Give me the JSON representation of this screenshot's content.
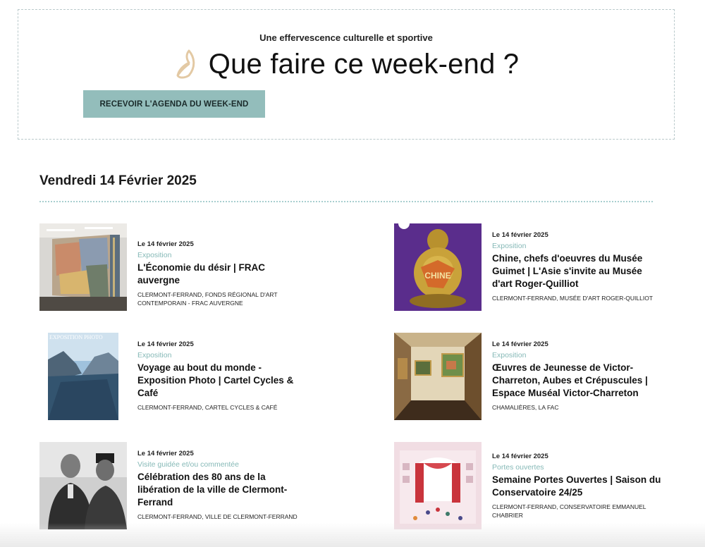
{
  "hero": {
    "subtitle": "Une effervescence culturelle et sportive",
    "title": "Que faire ce week-end ?",
    "button_label": "RECEVOIR L'AGENDA DU WEEK-END",
    "accent_color": "#93bdbb",
    "icon": "leaf-icon"
  },
  "day": {
    "heading": "Vendredi 14 Février 2025"
  },
  "events": [
    {
      "date": "Le 14 février 2025",
      "category": "Exposition",
      "title": "L'Économie du désir | FRAC auvergne",
      "location": "CLERMONT-FERRAND, FONDS RÉGIONAL D'ART CONTEMPORAIN - FRAC AUVERGNE",
      "thumb": "gallery-mural-image"
    },
    {
      "date": "Le 14 février 2025",
      "category": "Exposition",
      "title": "Chine, chefs d'oeuvres du Musée Guimet | L'Asie s'invite au Musée d'art Roger-Quilliot",
      "location": "CLERMONT-FERRAND, MUSÉE D'ART ROGER-QUILLIOT",
      "thumb": "buddha-statue-image",
      "thumb_text": "CHINE"
    },
    {
      "date": "Le 14 février 2025",
      "category": "Exposition",
      "title": "Voyage au bout du monde - Exposition Photo | Cartel Cycles & Café",
      "location": "CLERMONT-FERRAND, CARTEL CYCLES & CAFÉ",
      "thumb": "fjord-poster-image",
      "thumb_text": "EXPOSITION PHOTO"
    },
    {
      "date": "Le 14 février 2025",
      "category": "Exposition",
      "title": "Œuvres de Jeunesse de Victor-Charreton, Aubes et Crépuscules | Espace Muséal Victor-Charreton",
      "location": "CHAMALIÈRES, LA FAC",
      "thumb": "museum-room-image"
    },
    {
      "date": "Le 14 février 2025",
      "category": "Visite guidée et/ou commentée",
      "title": "Célébration des 80 ans de la libération de la ville de Clermont-Ferrand",
      "location": "CLERMONT-FERRAND, VILLE DE CLERMONT-FERRAND",
      "thumb": "historic-photo-image"
    },
    {
      "date": "Le 14 février 2025",
      "category": "Portes ouvertes",
      "title": "Semaine Portes Ouvertes | Saison du Conservatoire 24/25",
      "location": "CLERMONT-FERRAND, CONSERVATOIRE EMMANUEL CHABRIER",
      "thumb": "conservatoire-poster-image"
    }
  ]
}
